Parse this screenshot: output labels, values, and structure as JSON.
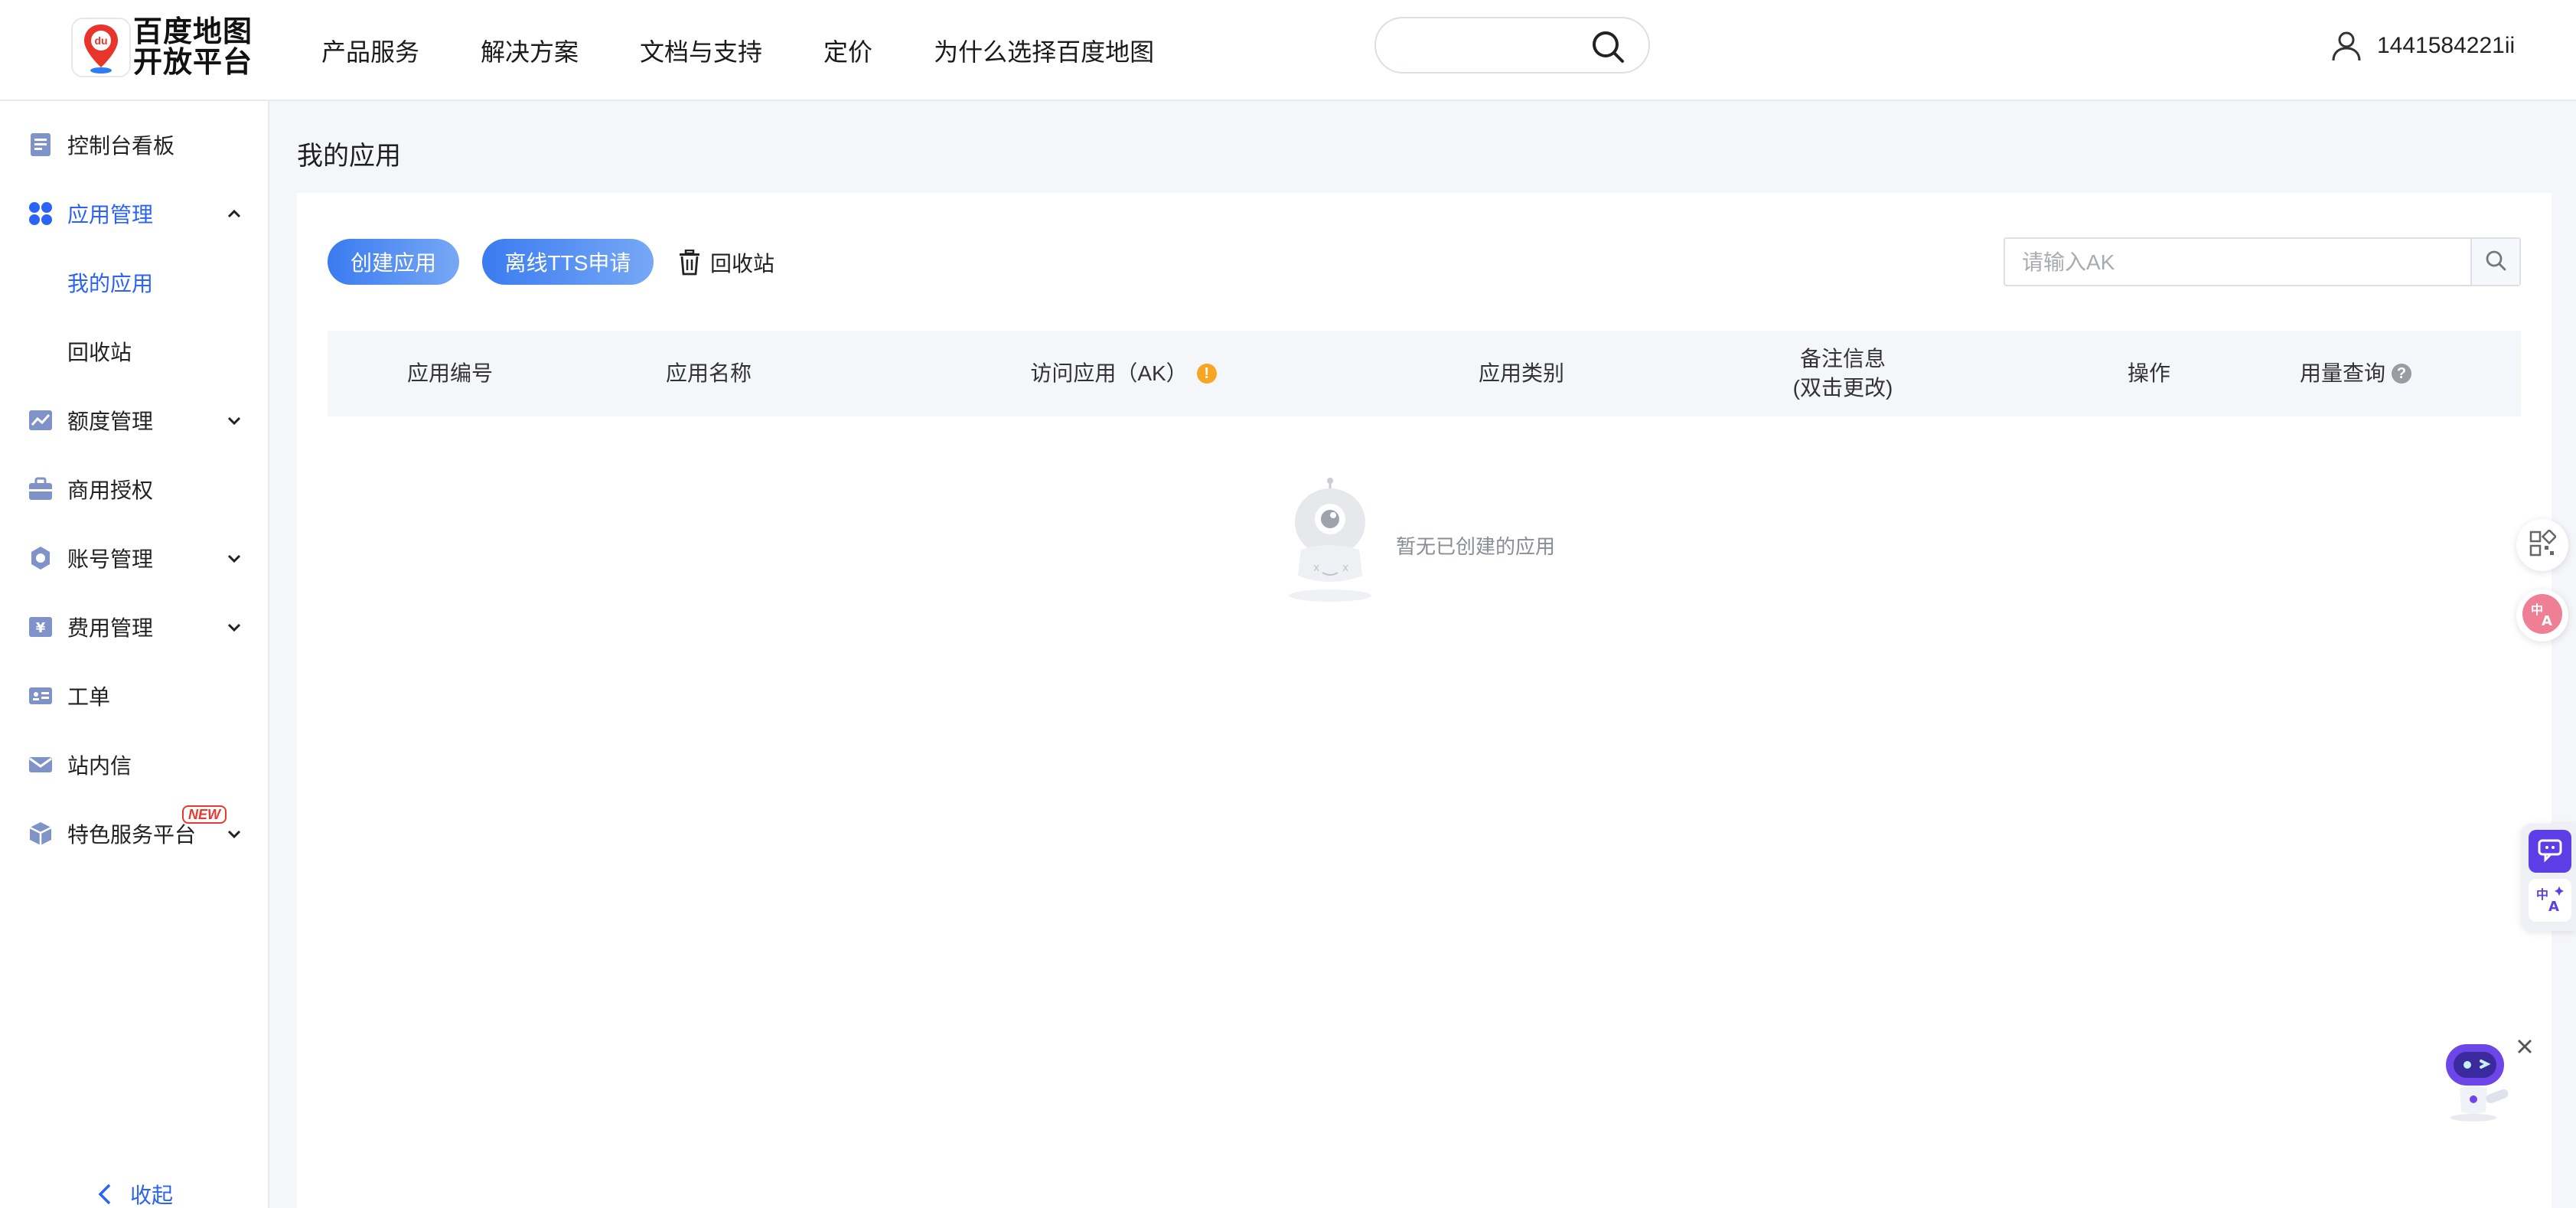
{
  "header": {
    "logo_text_line1": "百度地图",
    "logo_text_line2": "开放平台",
    "nav": [
      "产品服务",
      "解决方案",
      "文档与支持",
      "定价",
      "为什么选择百度地图"
    ],
    "search_placeholder": "",
    "username": "1441584221ii"
  },
  "sidebar": {
    "items": [
      {
        "label": "控制台看板",
        "icon": "dashboard-icon"
      },
      {
        "label": "应用管理",
        "icon": "apps-icon",
        "expanded": true
      },
      {
        "label": "我的应用",
        "sub": true,
        "selected": true
      },
      {
        "label": "回收站",
        "sub": true
      },
      {
        "label": "额度管理",
        "icon": "chart-icon",
        "expandable": true
      },
      {
        "label": "商用授权",
        "icon": "briefcase-icon"
      },
      {
        "label": "账号管理",
        "icon": "gear-icon",
        "expandable": true
      },
      {
        "label": "费用管理",
        "icon": "yen-icon",
        "expandable": true
      },
      {
        "label": "工单",
        "icon": "id-card-icon"
      },
      {
        "label": "站内信",
        "icon": "mail-icon"
      },
      {
        "label": "特色服务平台",
        "icon": "cube-icon",
        "expandable": true,
        "badge": "NEW"
      }
    ],
    "collapse_label": "收起"
  },
  "main": {
    "page_title": "我的应用",
    "create_button": "创建应用",
    "tts_button": "离线TTS申请",
    "recycle_label": "回收站",
    "ak_search_placeholder": "请输入AK",
    "table": {
      "columns": [
        "应用编号",
        "应用名称",
        "访问应用（AK）",
        "应用类别",
        "备注信息",
        "(双击更改)",
        "操作",
        "用量查询"
      ],
      "ak_tip_glyph": "!",
      "usage_tip_glyph": "?"
    },
    "empty_text": "暂无已创建的应用"
  },
  "colors": {
    "primary": "#2a63f5",
    "button_gradient_start": "#3a7bf0",
    "button_gradient_end": "#77a8f5",
    "warning": "#f6a623",
    "page_bg": "#f5f6f9"
  }
}
